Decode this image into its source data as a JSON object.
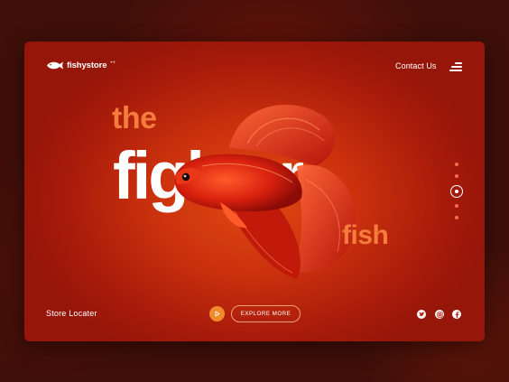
{
  "brand": {
    "name": "fishystore",
    "suffix": "•+"
  },
  "nav": {
    "contact_label": "Contact Us"
  },
  "hero": {
    "word_top": "the",
    "word_main": "fighter",
    "word_bottom": "fish"
  },
  "footer": {
    "store_label": "Store Locater",
    "explore_label": "EXPLORE MORE"
  },
  "icons": {
    "menu": "hamburger-icon",
    "play": "play-icon",
    "social": [
      "twitter-icon",
      "instagram-icon",
      "facebook-icon"
    ]
  },
  "colors": {
    "accent": "#f47c3c",
    "card": "#c9300d",
    "background": "#3f0f09",
    "play": "#f08a2a"
  }
}
